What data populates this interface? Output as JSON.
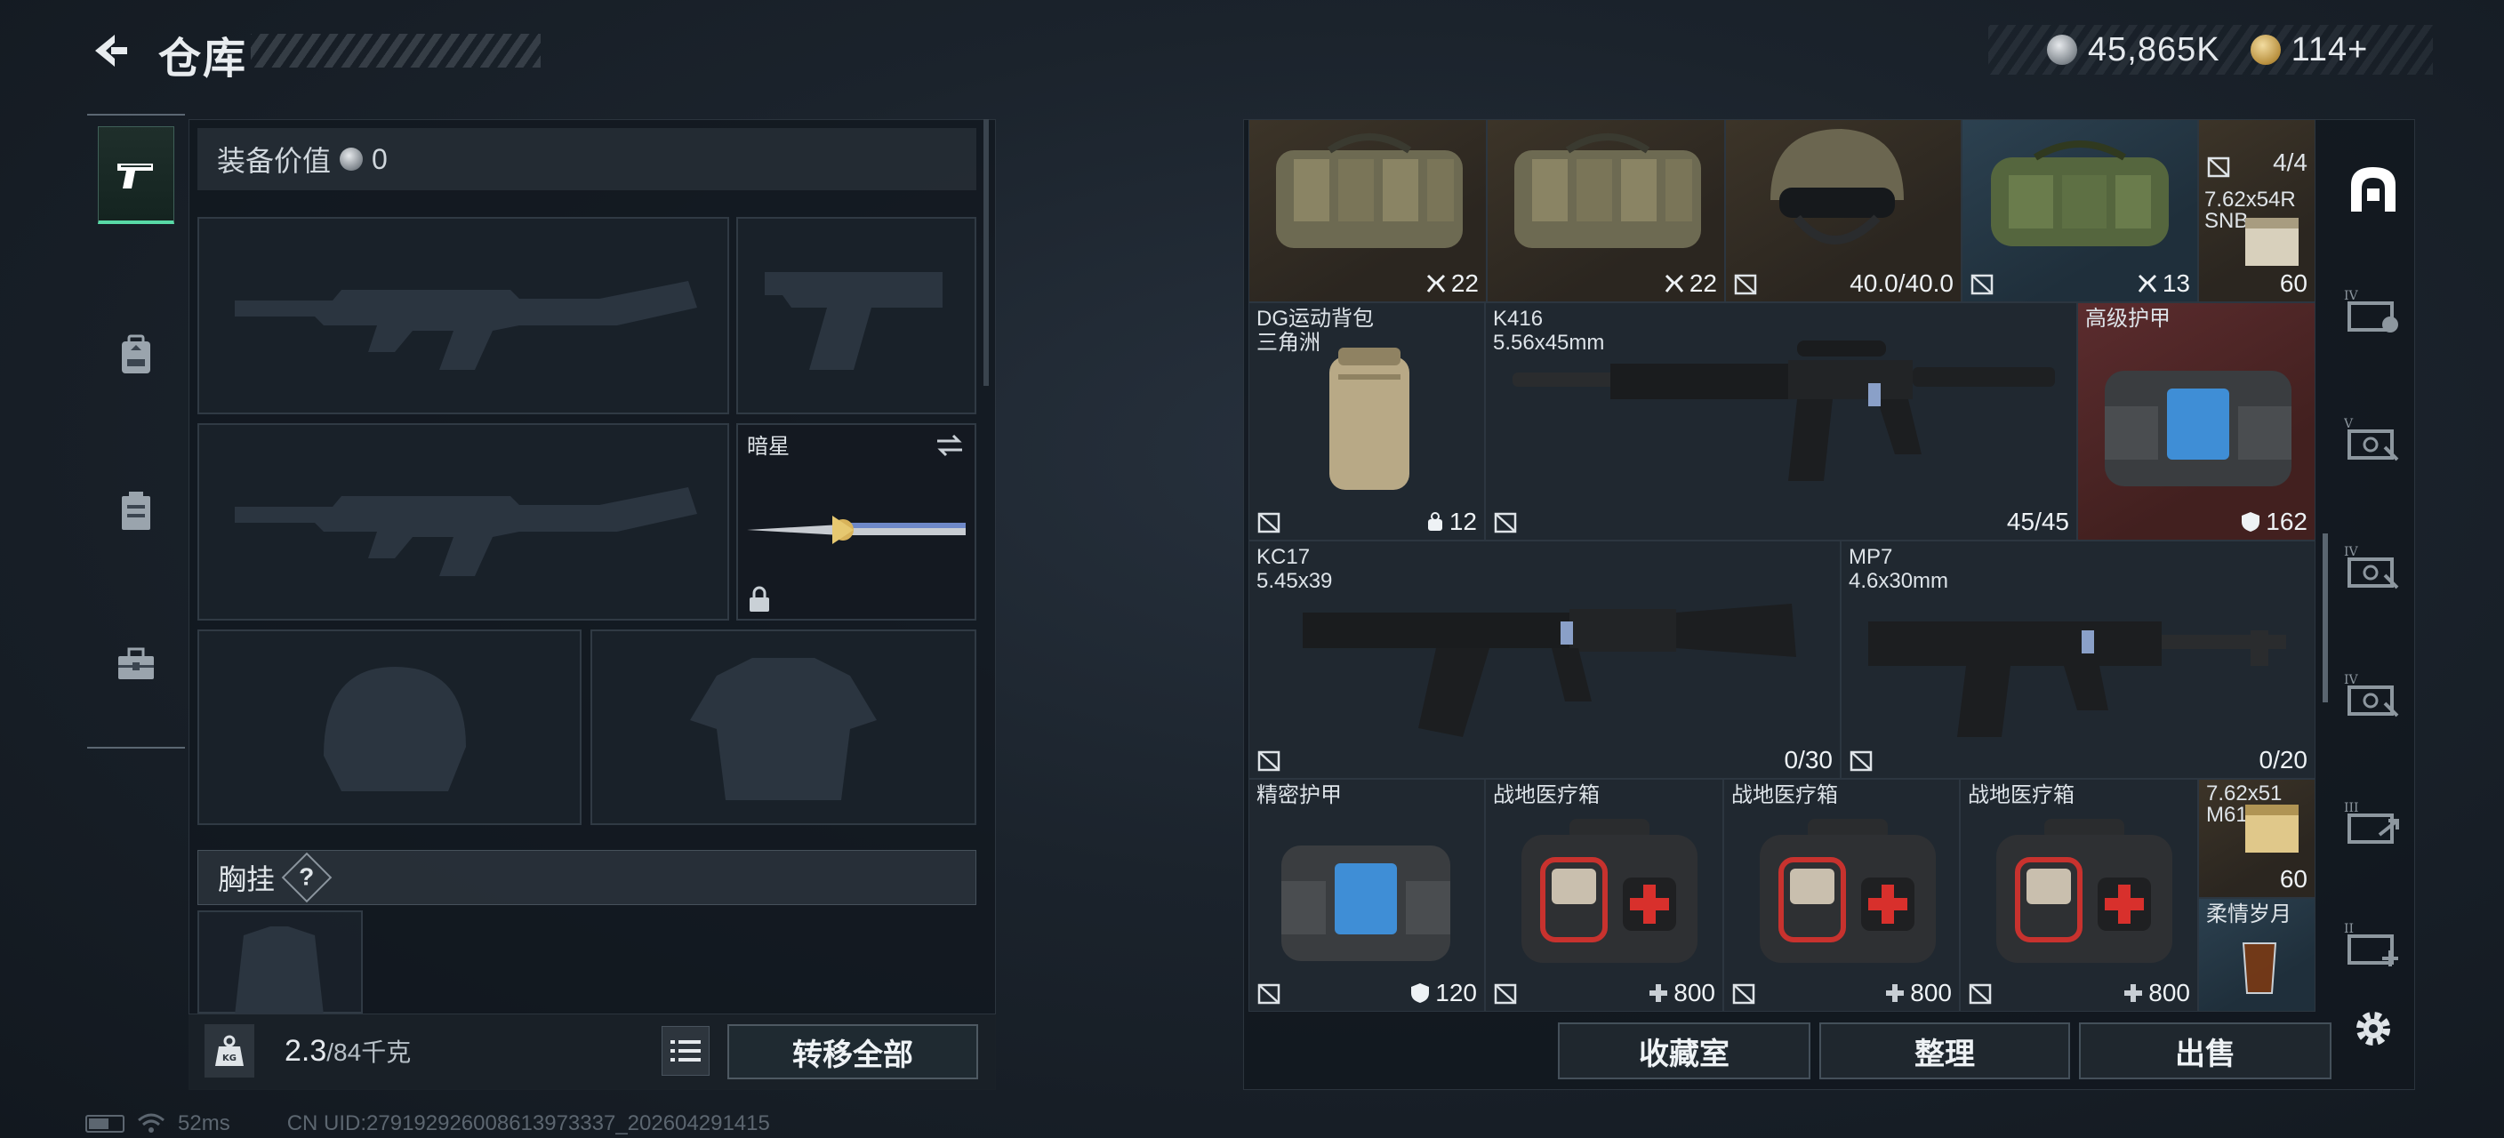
{
  "header": {
    "title": "仓库",
    "currency": [
      {
        "icon": "silver-coin-icon",
        "value": "45,865K"
      },
      {
        "icon": "gold-coin-icon",
        "value": "114+"
      }
    ]
  },
  "left_tabs": [
    {
      "icon": "pistol-icon",
      "active": true
    },
    {
      "icon": "backpack-icon",
      "active": false
    },
    {
      "icon": "clipboard-icon",
      "active": false
    },
    {
      "icon": "toolbox-icon",
      "active": false
    }
  ],
  "loadout": {
    "equip_value_label": "装备价值",
    "equip_value": "0",
    "melee_name": "暗星",
    "chest_rig_label": "胸挂",
    "chest_help": "?",
    "weight_current": "2.3",
    "weight_max": "/84千克",
    "transfer_all": "转移全部"
  },
  "storage": {
    "items": [
      {
        "id": "bag1",
        "count": "22",
        "count_icon": "grid-icon"
      },
      {
        "id": "bag2",
        "count": "22",
        "count_icon": "grid-icon"
      },
      {
        "id": "helmet",
        "count": "40.0/40.0"
      },
      {
        "id": "bag3",
        "count": "13",
        "count_icon": "grid-icon"
      },
      {
        "id": "ammo1",
        "name_line1": "7.62x54R",
        "name_line2": "SNB",
        "top_count": "4/4",
        "count": "60"
      },
      {
        "id": "backpack",
        "name_line1": "DG运动背包",
        "name_line2": "三角洲",
        "count": "12",
        "count_icon": "lock-bag-icon"
      },
      {
        "id": "k416",
        "name_line1": "K416",
        "name_line2": "5.56x45mm",
        "count": "45/45"
      },
      {
        "id": "armor-adv",
        "name_line1": "高级护甲",
        "count": "162",
        "count_icon": "shield-icon"
      },
      {
        "id": "kc17",
        "name_line1": "KC17",
        "name_line2": "5.45x39",
        "count": "0/30"
      },
      {
        "id": "mp7",
        "name_line1": "MP7",
        "name_line2": "4.6x30mm",
        "count": "0/20"
      },
      {
        "id": "armor-prec",
        "name_line1": "精密护甲",
        "count": "120",
        "count_icon": "shield-icon"
      },
      {
        "id": "medkit1",
        "name_line1": "战地医疗箱",
        "count": "800",
        "count_icon": "plus-icon"
      },
      {
        "id": "medkit2",
        "name_line1": "战地医疗箱",
        "count": "800",
        "count_icon": "plus-icon"
      },
      {
        "id": "medkit3",
        "name_line1": "战地医疗箱",
        "count": "800",
        "count_icon": "plus-icon"
      },
      {
        "id": "ammo2",
        "name_line1": "7.62x51",
        "name_line2": "M61",
        "count": "60"
      },
      {
        "id": "drink",
        "name_line1": "柔情岁月"
      }
    ]
  },
  "bottom_buttons": {
    "collection": "收藏室",
    "sort": "整理",
    "sell": "出售"
  },
  "right_rail": [
    "safe-box-icon",
    "tier-iv-container-icon",
    "tier-v-container-icon",
    "tier-iv-container-icon-2",
    "tier-iv-container-icon-3",
    "tier-iii-container-icon",
    "tier-ii-add-container-icon",
    "gear-icon"
  ],
  "status": {
    "ping": "52ms",
    "uid": "CN UID:279192926008613973337_202604291415"
  },
  "colors": {
    "accent": "#58d9a6",
    "rare_blue": "#2c4150",
    "rare_red": "#5b2c2e",
    "common_brown": "#3c3428"
  }
}
